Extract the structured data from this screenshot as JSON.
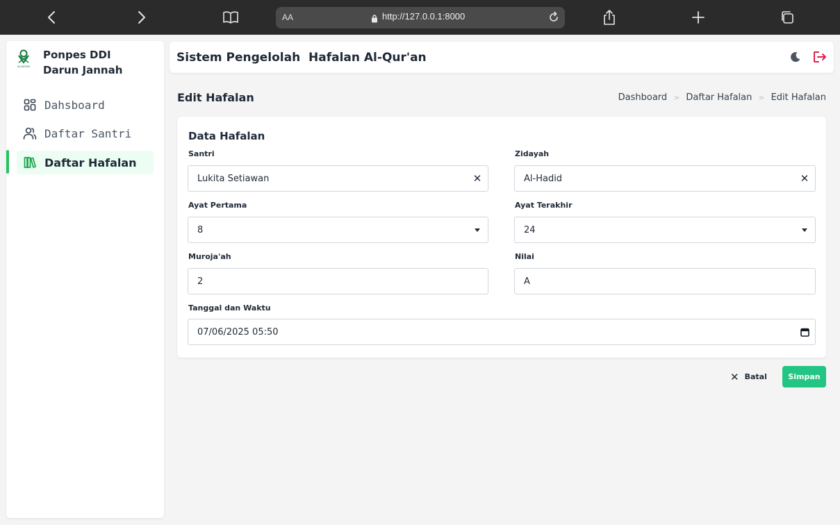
{
  "browser": {
    "aa_label": "AA",
    "url": "http://127.0.0.1:8000"
  },
  "sidebar": {
    "brand_line1": "Ponpes DDI",
    "brand_line2": "Darun Jannah",
    "logo_caption": "ALAUDDIN",
    "items": [
      {
        "label": "Dahsboard",
        "icon": "dashboard-icon",
        "active": false
      },
      {
        "label": "Daftar Santri",
        "icon": "users-icon",
        "active": false
      },
      {
        "label": "Daftar Hafalan",
        "icon": "books-icon",
        "active": true
      }
    ]
  },
  "header": {
    "title": "Sistem Pengelolah  Hafalan Al-Qur'an",
    "icons": [
      "moon-icon",
      "logout-icon"
    ]
  },
  "page": {
    "title": "Edit Hafalan",
    "breadcrumb": [
      "Dashboard",
      "Daftar Hafalan",
      "Edit Hafalan"
    ]
  },
  "form": {
    "card_title": "Data Hafalan",
    "santri": {
      "label": "Santri",
      "value": "Lukita Setiawan"
    },
    "zidayah": {
      "label": "Zidayah",
      "value": "Al-Hadid"
    },
    "ayat_pertama": {
      "label": "Ayat Pertama",
      "value": "8"
    },
    "ayat_terakhir": {
      "label": "Ayat Terakhir",
      "value": "24"
    },
    "murojaah": {
      "label": "Muroja'ah",
      "value": "2"
    },
    "nilai": {
      "label": "Nilai",
      "value": "A"
    },
    "tanggal": {
      "label": "Tanggal dan Waktu",
      "value": "07/06/2025 05:50"
    }
  },
  "actions": {
    "cancel_label": "Batal",
    "save_label": "Simpan"
  },
  "colors": {
    "accent": "#22c583",
    "active_bg": "#ecfdf3",
    "logout": "#e11d48",
    "logo": "#0f7a3c"
  }
}
